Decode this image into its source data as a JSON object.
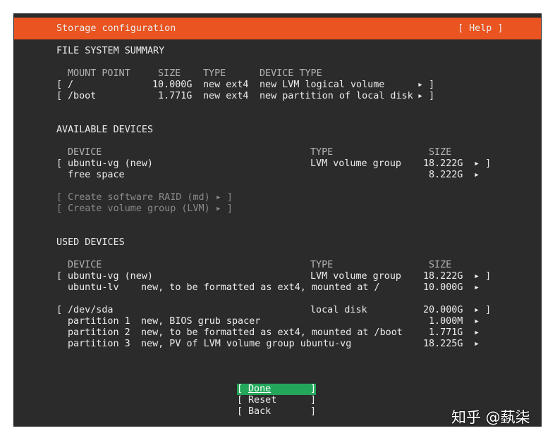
{
  "header": {
    "title": "Storage configuration",
    "help": "[ Help ]"
  },
  "fs_summary": {
    "heading": "FILE SYSTEM SUMMARY",
    "columns": [
      "MOUNT POINT",
      "SIZE",
      "TYPE",
      "DEVICE TYPE"
    ],
    "rows": [
      {
        "mount": "/",
        "size": "10.000G",
        "type": "new ext4",
        "device_type": "new LVM logical volume"
      },
      {
        "mount": "/boot",
        "size": "1.771G",
        "type": "new ext4",
        "device_type": "new partition of local disk"
      }
    ]
  },
  "available": {
    "heading": "AVAILABLE DEVICES",
    "columns": [
      "DEVICE",
      "TYPE",
      "SIZE"
    ],
    "vg": {
      "name": "ubuntu-vg (new)",
      "type": "LVM volume group",
      "size": "18.222G"
    },
    "free": {
      "name": "free space",
      "size": "8.222G"
    },
    "actions": [
      "[ Create software RAID (md) ▸ ]",
      "[ Create volume group (LVM) ▸ ]"
    ]
  },
  "used": {
    "heading": "USED DEVICES",
    "columns": [
      "DEVICE",
      "TYPE",
      "SIZE"
    ],
    "vg": {
      "name": "ubuntu-vg (new)",
      "type": "LVM volume group",
      "size": "18.222G"
    },
    "lv": {
      "name": "ubuntu-lv",
      "desc": "new, to be formatted as ext4, mounted at /",
      "size": "10.000G"
    },
    "disk": {
      "name": "/dev/sda",
      "type": "local disk",
      "size": "20.000G"
    },
    "partitions": [
      {
        "name": "partition 1",
        "desc": "new, BIOS grub spacer",
        "size": "1.000M"
      },
      {
        "name": "partition 2",
        "desc": "new, to be formatted as ext4, mounted at /boot",
        "size": "1.771G"
      },
      {
        "name": "partition 3",
        "desc": "new, PV of LVM volume group ubuntu-vg",
        "size": "18.225G"
      }
    ]
  },
  "buttons": {
    "done": "Done",
    "reset": "Reset",
    "back": "Back"
  },
  "watermark": "知乎 @蓺柒",
  "colors": {
    "accent": "#e95420",
    "background": "#2b2b2b",
    "done_highlight": "#24a65b",
    "text": "#ececec"
  }
}
